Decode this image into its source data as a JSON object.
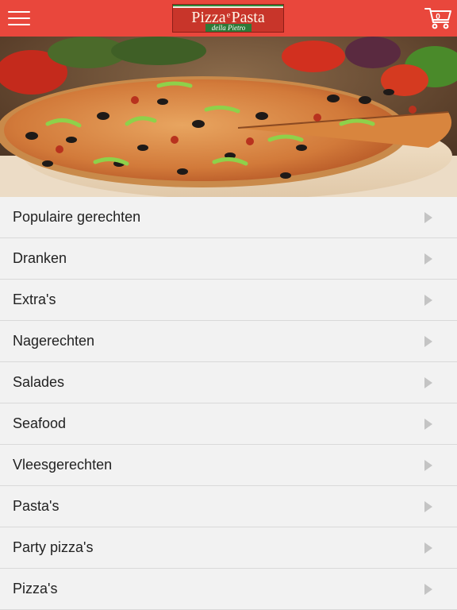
{
  "header": {
    "menu_icon": "hamburger-menu-icon",
    "logo": {
      "main": "Pizza",
      "connector": "e",
      "main2": "Pasta",
      "subtitle": "della Pietro"
    },
    "cart_icon": "shopping-cart-icon",
    "cart_count": "0",
    "colors": {
      "bar": "#e9473c",
      "logo_red": "#c8352a",
      "logo_green": "#2e7a38"
    }
  },
  "hero": {
    "image": "pizza-photo"
  },
  "categories": [
    {
      "label": "Populaire gerechten"
    },
    {
      "label": "Dranken"
    },
    {
      "label": "Extra's"
    },
    {
      "label": "Nagerechten"
    },
    {
      "label": "Salades"
    },
    {
      "label": "Seafood"
    },
    {
      "label": "Vleesgerechten"
    },
    {
      "label": "Pasta's"
    },
    {
      "label": "Party pizza's"
    },
    {
      "label": "Pizza's"
    }
  ],
  "chevron_icon": "chevron-right-icon"
}
